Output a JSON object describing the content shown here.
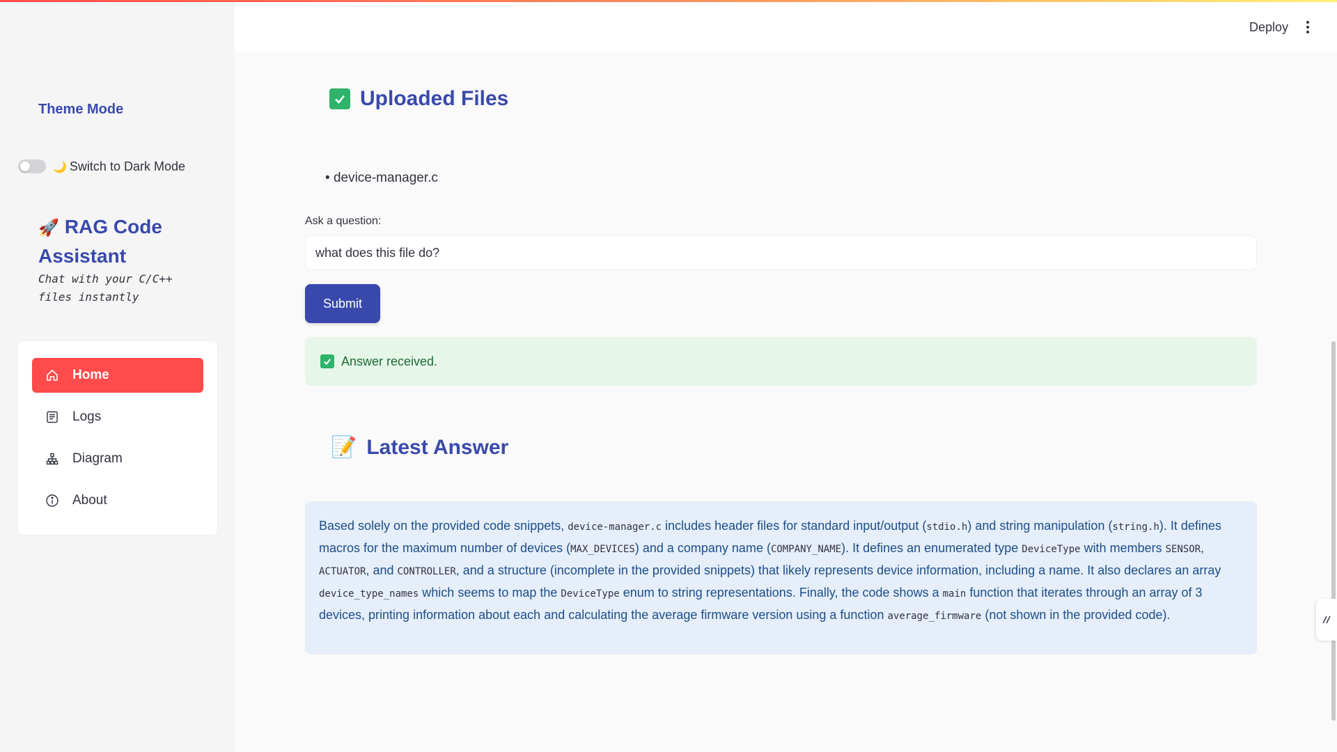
{
  "sidebar": {
    "theme_title": "Theme Mode",
    "toggle_label": "Switch to Dark Mode",
    "app_title": "RAG Code Assistant",
    "app_subtitle": "Chat with your C/C++ files instantly",
    "nav": [
      {
        "label": "Home",
        "icon": "home-icon",
        "active": true
      },
      {
        "label": "Logs",
        "icon": "logs-icon",
        "active": false
      },
      {
        "label": "Diagram",
        "icon": "diagram-icon",
        "active": false
      },
      {
        "label": "About",
        "icon": "info-icon",
        "active": false
      }
    ]
  },
  "header": {
    "deploy_label": "Deploy"
  },
  "main": {
    "uploaded_title": "Uploaded Files",
    "files": [
      "device-manager.c"
    ],
    "ask_label": "Ask a question:",
    "question_value": "what does this file do?",
    "submit_label": "Submit",
    "success_message": "Answer received.",
    "latest_title": "Latest Answer",
    "answer": {
      "p1": "Based solely on the provided code snippets, ",
      "c1": "device-manager.c",
      "p2": " includes header files for standard input/output (",
      "c2": "stdio.h",
      "p3": ") and string manipulation (",
      "c3": "string.h",
      "p4": "). It defines macros for the maximum number of devices (",
      "c4": "MAX_DEVICES",
      "p5": ") and a company name (",
      "c5": "COMPANY_NAME",
      "p6": "). It defines an enumerated type ",
      "c6": "DeviceType",
      "p7": " with members ",
      "c7": "SENSOR",
      "p8": ", ",
      "c8": "ACTUATOR",
      "p9": ", and ",
      "c9": "CONTROLLER",
      "p10": ", and a structure (incomplete in the provided snippets) that likely represents device information, including a name. It also declares an array ",
      "c10": "device_type_names",
      "p11": " which seems to map the ",
      "c11": "DeviceType",
      "p12": " enum to string representations. Finally, the code shows a ",
      "c12": "main",
      "p13": " function that iterates through an array of 3 devices, printing information about each and calculating the average firmware version using a function ",
      "c13": "average_firmware",
      "p14": " (not shown in the provided code)."
    }
  },
  "colors": {
    "accent": "#3949ab",
    "active_nav": "#ff4b4b",
    "success_bg": "#e6f6e9",
    "answer_bg": "#e5eef9"
  }
}
